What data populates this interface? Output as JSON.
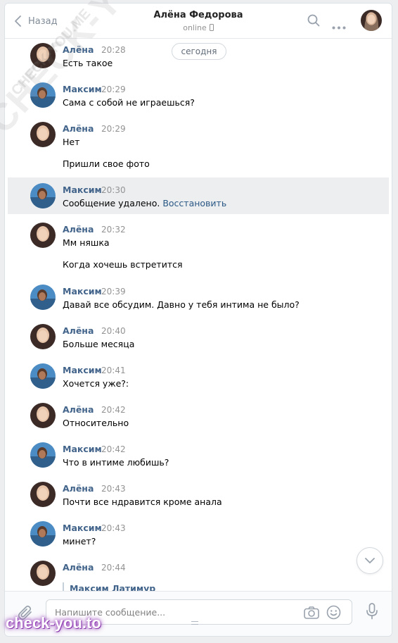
{
  "header": {
    "back_label": "Назад",
    "contact_name": "Алёна Федорова",
    "status": "online"
  },
  "date_chip": "сегодня",
  "messages": [
    {
      "author": "Алёна",
      "time": "20:28",
      "lines": [
        "Есть такое"
      ]
    },
    {
      "author": "Максим",
      "time": "20:29",
      "lines": [
        "Сама с собой не играешься?"
      ]
    },
    {
      "author": "Алёна",
      "time": "20:29",
      "lines": [
        "Нет",
        "Пришли свое фото"
      ]
    },
    {
      "author": "Максим",
      "time": "20:30",
      "deleted_text": "Сообщение удалено.",
      "restore_label": "Восстановить"
    },
    {
      "author": "Алёна",
      "time": "20:32",
      "lines": [
        "Мм няшка",
        "Когда хочешь встретится"
      ]
    },
    {
      "author": "Максим",
      "time": "20:39",
      "lines": [
        "Давай все обсудим. Давно у тебя интима не было?"
      ]
    },
    {
      "author": "Алёна",
      "time": "20:40",
      "lines": [
        "Больше месяца"
      ]
    },
    {
      "author": "Максим",
      "time": "20:41",
      "lines": [
        "Хочется уже?:"
      ]
    },
    {
      "author": "Алёна",
      "time": "20:42",
      "lines": [
        "Относительно"
      ]
    },
    {
      "author": "Максим",
      "time": "20:42",
      "lines": [
        "Что в интиме любишь?"
      ]
    },
    {
      "author": "Алёна",
      "time": "20:43",
      "lines": [
        "Почти все ндравится кроме анала"
      ]
    },
    {
      "author": "Максим",
      "time": "20:43",
      "lines": [
        "минет?"
      ]
    },
    {
      "author": "Алёна",
      "time": "20:44",
      "quote_author": "Максим Латимур"
    }
  ],
  "composer": {
    "placeholder": "Напишите сообщение..."
  },
  "watermarks": {
    "diagonal": "CHECK-YOU.ME",
    "small": "CHECK-YOU.ME",
    "badge": "check-you.to"
  },
  "colors": {
    "author_name": "#42648b",
    "link": "#2a5885",
    "deleted_bg": "#edeef0"
  }
}
